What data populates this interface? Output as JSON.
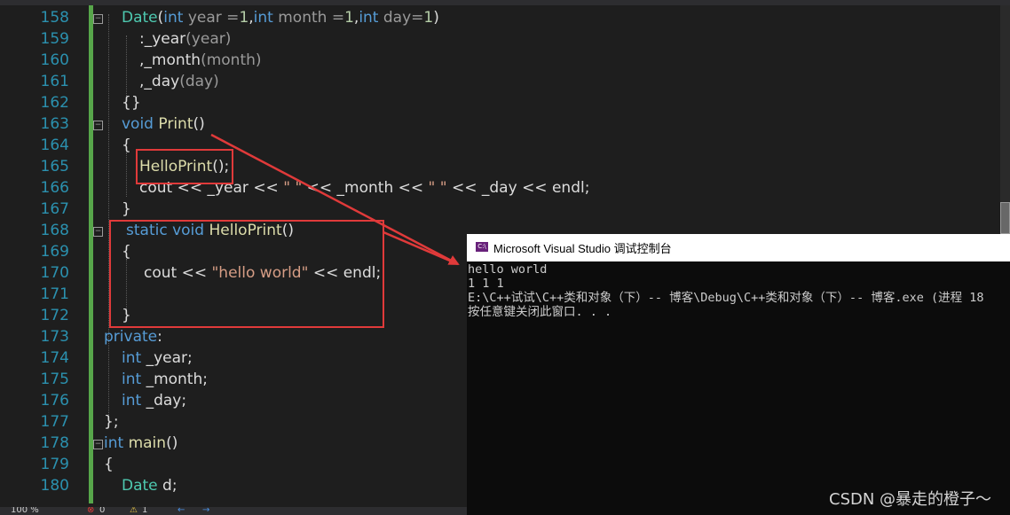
{
  "editor": {
    "lines": [
      {
        "num": "158",
        "tokens": [
          {
            "t": "Date",
            "c": "t"
          },
          {
            "t": "(",
            "c": "m"
          },
          {
            "t": "int",
            "c": "k"
          },
          {
            "t": " year =",
            "c": "p"
          },
          {
            "t": "1",
            "c": "n"
          },
          {
            "t": ",",
            "c": "m"
          },
          {
            "t": "int",
            "c": "k"
          },
          {
            "t": " month =",
            "c": "p"
          },
          {
            "t": "1",
            "c": "n"
          },
          {
            "t": ",",
            "c": "m"
          },
          {
            "t": "int",
            "c": "k"
          },
          {
            "t": " day=",
            "c": "p"
          },
          {
            "t": "1",
            "c": "n"
          },
          {
            "t": ")",
            "c": "m"
          }
        ]
      },
      {
        "num": "159",
        "tokens": [
          {
            "t": ":",
            "c": "m"
          },
          {
            "t": "_year",
            "c": "m"
          },
          {
            "t": "(year)",
            "c": "p"
          }
        ]
      },
      {
        "num": "160",
        "tokens": [
          {
            "t": ",",
            "c": "m"
          },
          {
            "t": "_month",
            "c": "m"
          },
          {
            "t": "(month)",
            "c": "p"
          }
        ]
      },
      {
        "num": "161",
        "tokens": [
          {
            "t": ",",
            "c": "m"
          },
          {
            "t": "_day",
            "c": "m"
          },
          {
            "t": "(day)",
            "c": "p"
          }
        ]
      },
      {
        "num": "162",
        "tokens": [
          {
            "t": "{}",
            "c": "m"
          }
        ]
      },
      {
        "num": "163",
        "tokens": [
          {
            "t": "void",
            "c": "k"
          },
          {
            "t": " ",
            "c": "m"
          },
          {
            "t": "Print",
            "c": "f"
          },
          {
            "t": "()",
            "c": "m"
          }
        ]
      },
      {
        "num": "164",
        "tokens": [
          {
            "t": "{",
            "c": "m"
          }
        ]
      },
      {
        "num": "165",
        "tokens": [
          {
            "t": "HelloPrint",
            "c": "f"
          },
          {
            "t": "();",
            "c": "m"
          }
        ]
      },
      {
        "num": "166",
        "tokens": [
          {
            "t": "cout << _year << ",
            "c": "m"
          },
          {
            "t": "\" \"",
            "c": "s"
          },
          {
            "t": " << _month << ",
            "c": "m"
          },
          {
            "t": "\" \"",
            "c": "s"
          },
          {
            "t": " << _day << endl;",
            "c": "m"
          }
        ]
      },
      {
        "num": "167",
        "tokens": [
          {
            "t": "}",
            "c": "m"
          }
        ]
      },
      {
        "num": "168",
        "tokens": [
          {
            "t": "static",
            "c": "k"
          },
          {
            "t": " ",
            "c": "m"
          },
          {
            "t": "void",
            "c": "k"
          },
          {
            "t": " ",
            "c": "m"
          },
          {
            "t": "HelloPrint",
            "c": "f"
          },
          {
            "t": "()",
            "c": "m"
          }
        ]
      },
      {
        "num": "169",
        "tokens": [
          {
            "t": "{",
            "c": "m"
          }
        ]
      },
      {
        "num": "170",
        "tokens": [
          {
            "t": "cout << ",
            "c": "m"
          },
          {
            "t": "\"hello world\"",
            "c": "s"
          },
          {
            "t": " << endl;",
            "c": "m"
          }
        ]
      },
      {
        "num": "171",
        "tokens": []
      },
      {
        "num": "172",
        "tokens": [
          {
            "t": "}",
            "c": "m"
          }
        ]
      },
      {
        "num": "173",
        "tokens": [
          {
            "t": "private",
            "c": "k"
          },
          {
            "t": ":",
            "c": "m"
          }
        ]
      },
      {
        "num": "174",
        "tokens": [
          {
            "t": "int",
            "c": "k"
          },
          {
            "t": " _year;",
            "c": "m"
          }
        ]
      },
      {
        "num": "175",
        "tokens": [
          {
            "t": "int",
            "c": "k"
          },
          {
            "t": " _month;",
            "c": "m"
          }
        ]
      },
      {
        "num": "176",
        "tokens": [
          {
            "t": "int",
            "c": "k"
          },
          {
            "t": " _day;",
            "c": "m"
          }
        ]
      },
      {
        "num": "177",
        "tokens": [
          {
            "t": "};",
            "c": "m"
          }
        ]
      },
      {
        "num": "178",
        "tokens": [
          {
            "t": "int",
            "c": "k"
          },
          {
            "t": " ",
            "c": "m"
          },
          {
            "t": "main",
            "c": "f"
          },
          {
            "t": "()",
            "c": "m"
          }
        ]
      },
      {
        "num": "179",
        "tokens": [
          {
            "t": "{",
            "c": "m"
          }
        ]
      },
      {
        "num": "180",
        "tokens": [
          {
            "t": "Date",
            "c": "t"
          },
          {
            "t": " d;",
            "c": "m"
          }
        ]
      }
    ]
  },
  "console": {
    "title": "Microsoft Visual Studio 调试控制台",
    "icon": "vs-console-icon",
    "output": [
      "hello world",
      "1 1 1",
      "",
      "E:\\C++试试\\C++类和对象（下）-- 博客\\Debug\\C++类和对象（下）-- 博客.exe (进程 18",
      "按任意键关闭此窗口. . ."
    ]
  },
  "statusbar": {
    "zoom": "100 %",
    "errors": "0",
    "warnings": "1"
  },
  "watermark": "CSDN @暴走的橙子～",
  "colors": {
    "keyword": "#569cd6",
    "type": "#4ec9b0",
    "function": "#dcdcaa",
    "string": "#d69d85",
    "number": "#b5cea8",
    "parameter": "#9a9a9a",
    "highlight_box": "#e03a3a"
  }
}
